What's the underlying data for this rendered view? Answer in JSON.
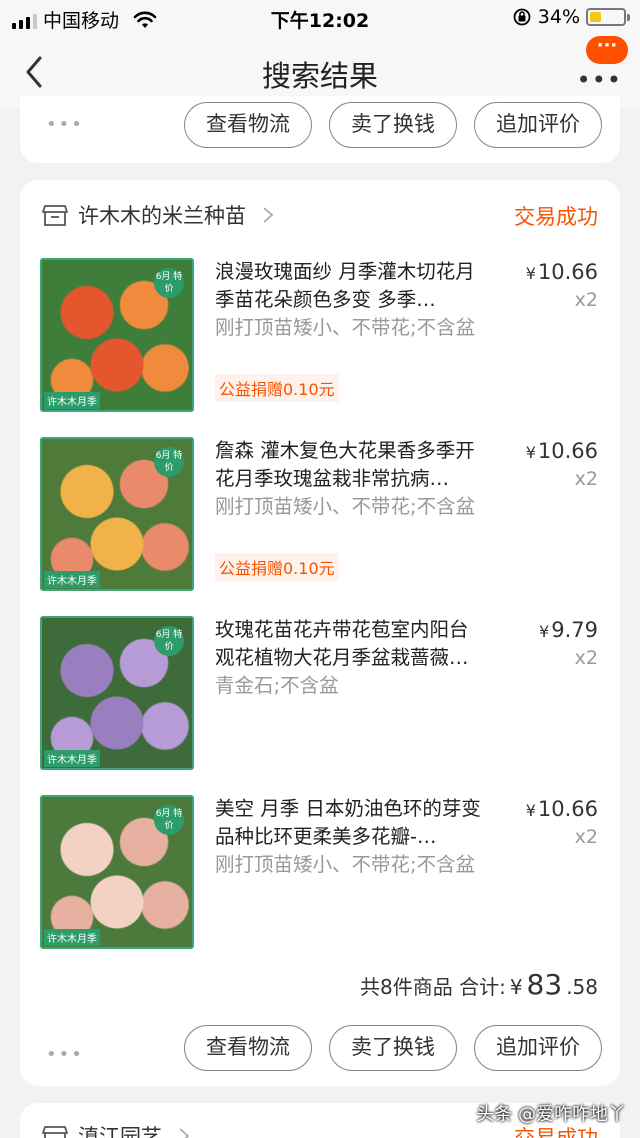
{
  "status_bar": {
    "carrier": "中国移动",
    "time": "下午12:02",
    "battery": "34%",
    "battery_level": 0.34
  },
  "nav": {
    "title": "搜索结果",
    "more_badge": "···",
    "more_dots": "•••"
  },
  "prev_order": {
    "ellipsis": "•••",
    "buttons": [
      "查看物流",
      "卖了换钱",
      "追加评价"
    ]
  },
  "order": {
    "shop_name": "许木木的米兰种苗",
    "status": "交易成功",
    "items": [
      {
        "title": "浪漫玫瑰面纱 月季灌木切花月季苗花朵颜色多变 多季…",
        "sku": "刚打顶苗矮小、不带花;不含盆",
        "charity": "公益捐赠0.10元",
        "price": "10.66",
        "qty": "x2",
        "tag": "6月\n特价",
        "wm": "许木木月季",
        "colors": [
          "#e4572e",
          "#f08a3c",
          "#3f7d3a"
        ]
      },
      {
        "title": "詹森 灌木复色大花果香多季开花月季玫瑰盆栽非常抗病…",
        "sku": "刚打顶苗矮小、不带花;不含盆",
        "charity": "公益捐赠0.10元",
        "price": "10.66",
        "qty": "x2",
        "tag": "6月\n特价",
        "wm": "许木木月季",
        "colors": [
          "#f2b24a",
          "#e98a6b",
          "#4f7b3a"
        ]
      },
      {
        "title": "玫瑰花苗花卉带花苞室内阳台观花植物大花月季盆栽蔷薇…",
        "sku": "青金石;不含盆",
        "charity": "",
        "price": "9.79",
        "qty": "x2",
        "tag": "6月\n特价",
        "wm": "许木木月季",
        "colors": [
          "#9a7fc0",
          "#b79bd6",
          "#3d6b3a"
        ]
      },
      {
        "title": "美空 月季 日本奶油色环的芽变品种比环更柔美多花瓣-…",
        "sku": "刚打顶苗矮小、不带花;不含盆",
        "charity": "",
        "price": "10.66",
        "qty": "x2",
        "tag": "6月\n特价",
        "wm": "许木木月季",
        "colors": [
          "#f3d2c4",
          "#e8b0a0",
          "#4c7a3c"
        ]
      }
    ],
    "summary_prefix": "共8件商品 合计:",
    "total_currency": "¥",
    "total_int": "83",
    "total_dec": ".58",
    "ellipsis": "•••",
    "buttons": [
      "查看物流",
      "卖了换钱",
      "追加评价"
    ]
  },
  "next_order": {
    "shop_name": "滇江园艺",
    "status": "交易成功"
  },
  "watermark": "头条 @爱咋咋地丫",
  "currency": "¥"
}
